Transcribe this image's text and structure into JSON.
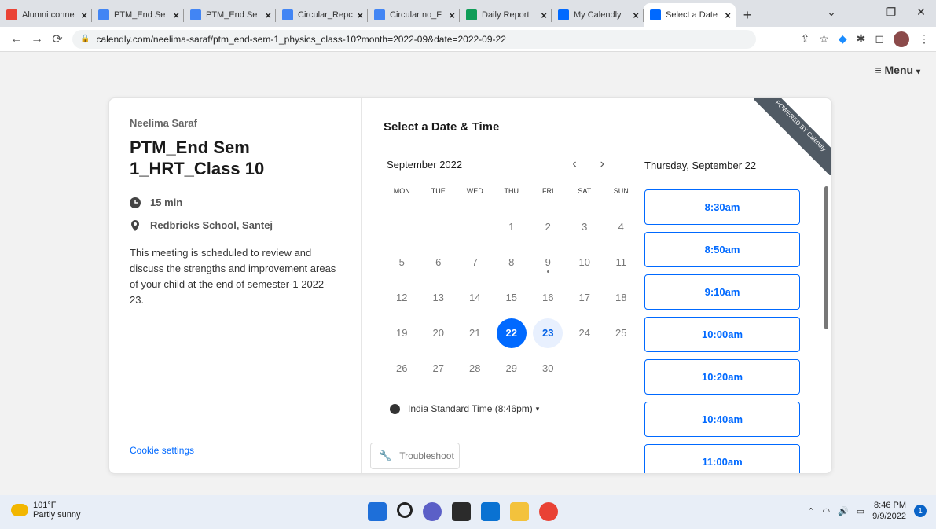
{
  "browser": {
    "tabs": [
      {
        "title": "Alumni conne",
        "favicon": "gmail-icon",
        "color": "#ea4335"
      },
      {
        "title": "PTM_End Se",
        "favicon": "docs-icon",
        "color": "#4285f4"
      },
      {
        "title": "PTM_End Se",
        "favicon": "docs-icon",
        "color": "#4285f4"
      },
      {
        "title": "Circular_Repc",
        "favicon": "docs-icon",
        "color": "#4285f4"
      },
      {
        "title": "Circular no_F",
        "favicon": "docs-icon",
        "color": "#4285f4"
      },
      {
        "title": "Daily Report",
        "favicon": "sheets-icon",
        "color": "#0f9d58"
      },
      {
        "title": "My Calendly",
        "favicon": "calendly-icon",
        "color": "#0069ff"
      },
      {
        "title": "Select a Date",
        "favicon": "calendly-icon",
        "color": "#0069ff"
      }
    ],
    "url": "calendly.com/neelima-saraf/ptm_end-sem-1_physics_class-10?month=2022-09&date=2022-09-22"
  },
  "page": {
    "menu_label": "Menu",
    "ribbon_text": "POWERED BY Calendly"
  },
  "event": {
    "host": "Neelima Saraf",
    "title": "PTM_End Sem 1_HRT_Class 10",
    "duration": "15 min",
    "location": "Redbricks School, Santej",
    "description": "This meeting is scheduled to review and discuss the strengths and improvement areas of your child at the end of semester-1 2022-23.",
    "cookie_settings": "Cookie settings"
  },
  "calendar": {
    "heading": "Select a Date & Time",
    "month": "September 2022",
    "weekdays": [
      "MON",
      "TUE",
      "WED",
      "THU",
      "FRI",
      "SAT",
      "SUN"
    ],
    "leading_blanks": 3,
    "days": [
      "1",
      "2",
      "3",
      "4",
      "5",
      "6",
      "7",
      "8",
      "9",
      "10",
      "11",
      "12",
      "13",
      "14",
      "15",
      "16",
      "17",
      "18",
      "19",
      "20",
      "21",
      "22",
      "23",
      "24",
      "25",
      "26",
      "27",
      "28",
      "29",
      "30"
    ],
    "today": "9",
    "selected": "22",
    "available": [
      "23"
    ],
    "timezone": "India Standard Time (8:46pm)",
    "troubleshoot": "Troubleshoot"
  },
  "slots": {
    "day_label": "Thursday, September 22",
    "times": [
      "8:30am",
      "8:50am",
      "9:10am",
      "10:00am",
      "10:20am",
      "10:40am",
      "11:00am"
    ]
  },
  "taskbar": {
    "temp": "101°F",
    "weather": "Partly sunny",
    "time": "8:46 PM",
    "date": "9/9/2022",
    "notifications": "1"
  }
}
